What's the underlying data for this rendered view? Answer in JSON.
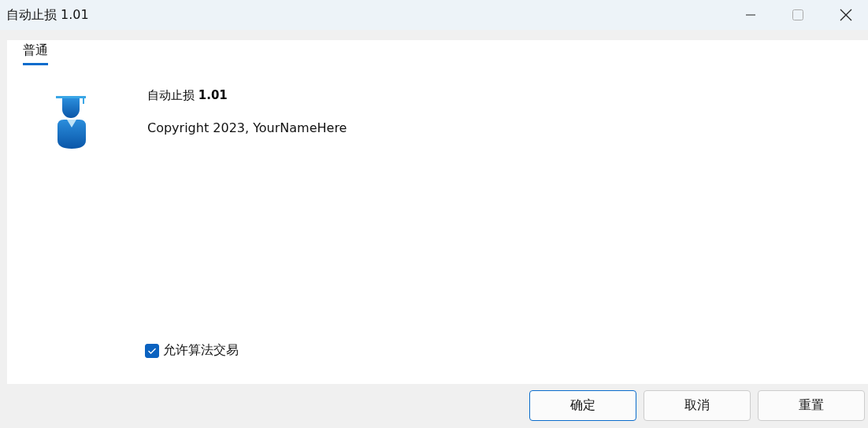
{
  "window": {
    "title": "自动止损 1.01"
  },
  "tabs": [
    {
      "label": "普通",
      "selected": true
    }
  ],
  "about": {
    "name": "自动止损 **1.01**",
    "copyright": "Copyright 2023, YourNameHere"
  },
  "options": [
    {
      "label": "允许算法交易",
      "checked": true
    }
  ],
  "buttons": [
    {
      "label": "确定",
      "selected": true
    },
    {
      "label": "取消",
      "selected": false
    },
    {
      "label": "重置",
      "selected": false
    }
  ]
}
